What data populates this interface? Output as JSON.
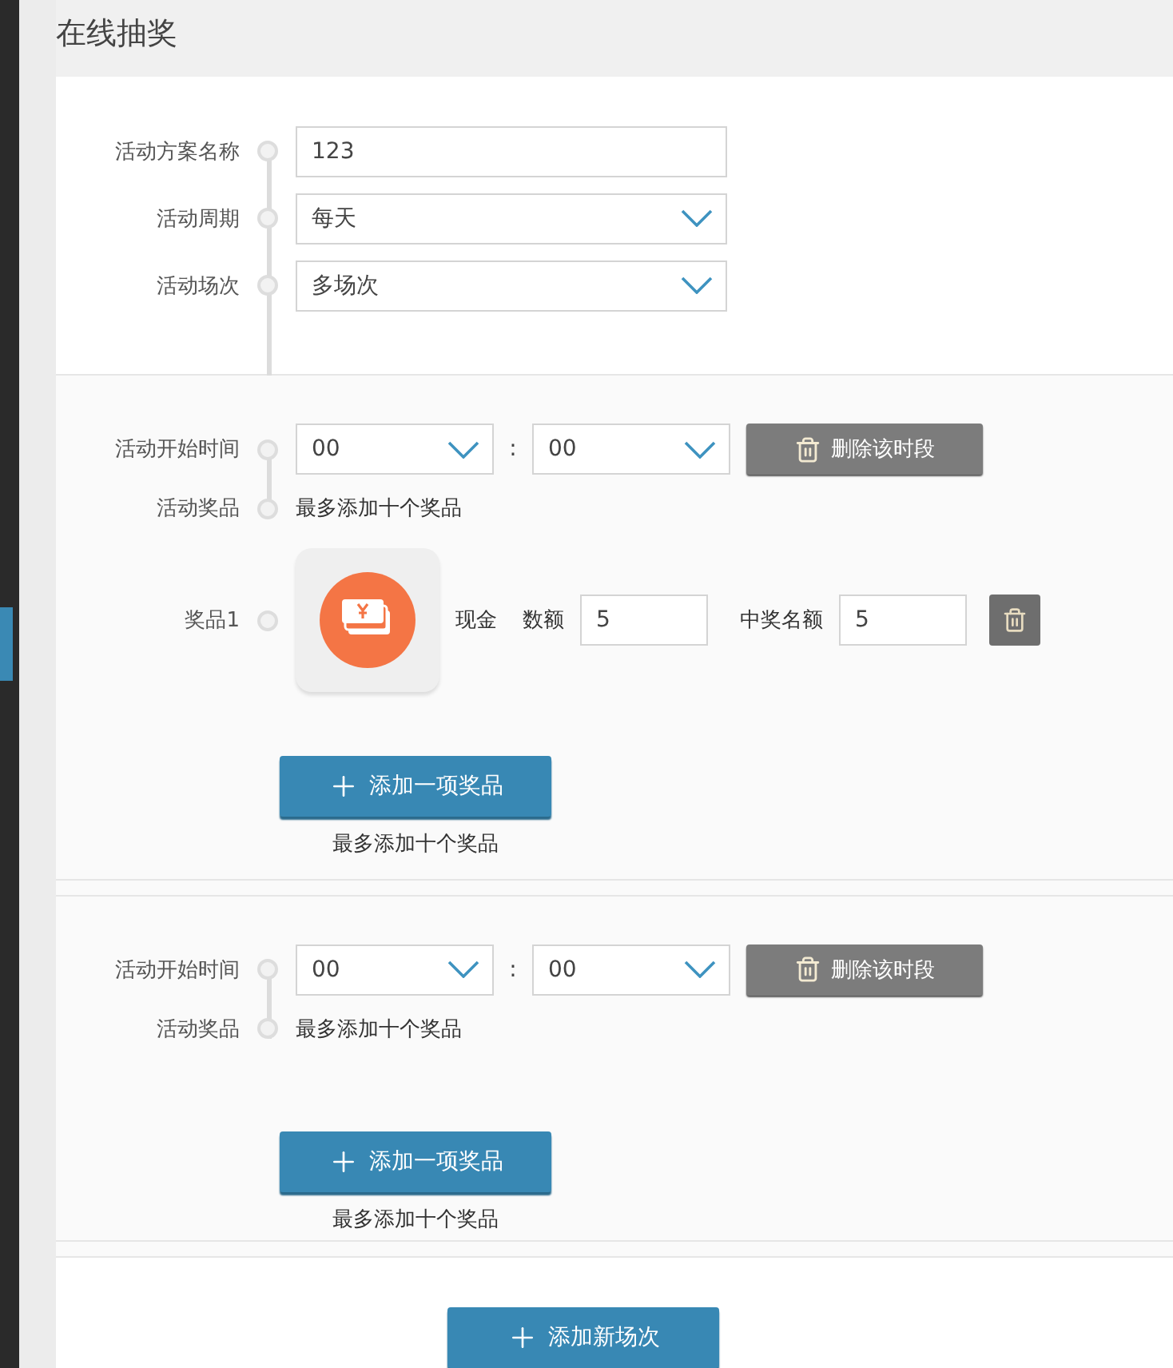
{
  "page": {
    "title": "在线抽奖"
  },
  "basic": [
    {
      "label": "活动方案名称",
      "kind": "input",
      "value": "123"
    },
    {
      "label": "活动周期",
      "kind": "select",
      "value": "每天"
    },
    {
      "label": "活动场次",
      "kind": "select",
      "value": "多场次"
    }
  ],
  "sessions": [
    {
      "start_label": "活动开始时间",
      "hour": "00",
      "separator": ":",
      "minute": "00",
      "delete_button": "删除该时段",
      "prizes_label": "活动奖品",
      "prizes_hint": "最多添加十个奖品",
      "prizes": [
        {
          "label": "奖品1",
          "type": "现金",
          "amount_label": "数额",
          "amount": "5",
          "winners_label": "中奖名额",
          "winners": "5"
        }
      ],
      "add_button": "添加一项奖品",
      "add_note": "最多添加十个奖品"
    },
    {
      "start_label": "活动开始时间",
      "hour": "00",
      "separator": ":",
      "minute": "00",
      "delete_button": "删除该时段",
      "prizes_label": "活动奖品",
      "prizes_hint": "最多添加十个奖品",
      "add_button": "添加一项奖品",
      "add_note": "最多添加十个奖品"
    }
  ],
  "add_session_button": "添加新场次"
}
